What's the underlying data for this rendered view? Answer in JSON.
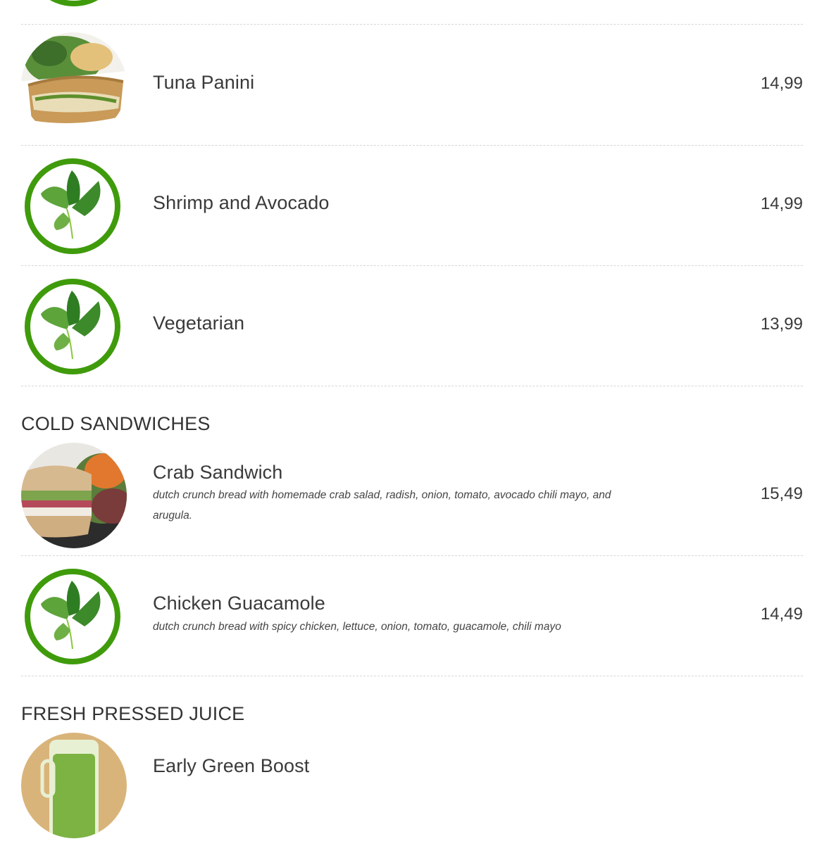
{
  "sections": [
    {
      "title": "",
      "items": [
        {
          "name": "Tuna Panini",
          "description": "",
          "price": "14,99",
          "image": "tuna-panini-photo"
        },
        {
          "name": "Shrimp and Avocado",
          "description": "",
          "price": "14,99",
          "image": "leaf-placeholder-icon"
        },
        {
          "name": "Vegetarian",
          "description": "",
          "price": "13,99",
          "image": "leaf-placeholder-icon"
        }
      ]
    },
    {
      "title": "COLD SANDWICHES",
      "items": [
        {
          "name": "Crab Sandwich",
          "description": "dutch crunch bread with homemade crab salad, radish, onion, tomato, avocado chili mayo, and arugula.",
          "price": "15,49",
          "image": "crab-sandwich-photo"
        },
        {
          "name": "Chicken Guacamole",
          "description": "dutch crunch bread with spicy chicken, lettuce, onion, tomato, guacamole, chili mayo",
          "price": "14,49",
          "image": "leaf-placeholder-icon"
        }
      ]
    },
    {
      "title": "FRESH PRESSED JUICE",
      "items": [
        {
          "name": "Early Green Boost",
          "description": "",
          "price": "",
          "image": "green-juice-photo"
        }
      ]
    }
  ],
  "colors": {
    "leaf_ring": "#3f9b0b",
    "leaf_dark": "#2f7d23",
    "leaf_light": "#5da43a",
    "divider": "#d6d6d6",
    "text": "#333333"
  }
}
